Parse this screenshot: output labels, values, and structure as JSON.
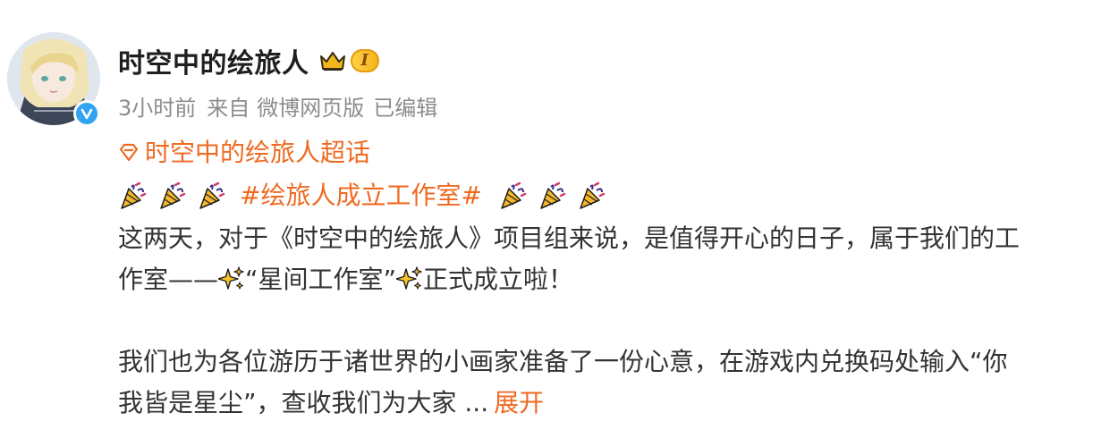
{
  "post": {
    "author": "时空中的绘旅人",
    "level_badge": "I",
    "time": "3小时前",
    "source_prefix": "来自",
    "source": "微博网页版",
    "edited": "已编辑",
    "supertopic": "时空中的绘旅人超话",
    "hashtag": "#绘旅人成立工作室#",
    "line1": "这两天，对于《时空中的绘旅人》项目组来说，是值得开心的日子，属于我们的工",
    "line2_a": "作室——",
    "line2_b": "“星间工作室”",
    "line2_c": "正式成立啦！",
    "line3": "我们也为各位游历于诸世界的小画家准备了一份心意，在游戏内兑换码处输入“你",
    "line4": "我皆是星尘”，查收我们为大家 ...",
    "expand_label": "展开"
  },
  "colors": {
    "accent": "#ef6a21",
    "meta": "#8c8c8c",
    "verified": "#2fa4f0"
  },
  "icons": [
    "avatar",
    "verified-icon",
    "crown-icon",
    "supertopic-icon",
    "party-popper-icon",
    "sparkles-icon"
  ]
}
